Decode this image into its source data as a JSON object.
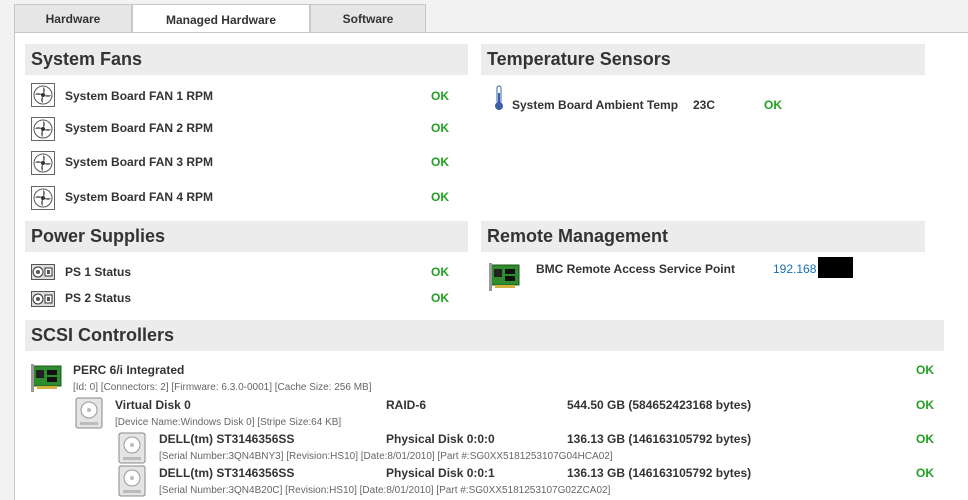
{
  "tabs": [
    {
      "label": "Hardware"
    },
    {
      "label": "Managed Hardware"
    },
    {
      "label": "Software"
    }
  ],
  "fans": {
    "title": "System Fans",
    "items": [
      {
        "label": "System Board FAN 1 RPM",
        "status": "OK"
      },
      {
        "label": "System Board FAN 2 RPM",
        "status": "OK"
      },
      {
        "label": "System Board FAN 3 RPM",
        "status": "OK"
      },
      {
        "label": "System Board FAN 4 RPM",
        "status": "OK"
      }
    ]
  },
  "temps": {
    "title": "Temperature Sensors",
    "items": [
      {
        "label": "System Board Ambient Temp",
        "value": "23C",
        "status": "OK"
      }
    ]
  },
  "power": {
    "title": "Power Supplies",
    "items": [
      {
        "label": "PS 1 Status",
        "status": "OK"
      },
      {
        "label": "PS 2 Status",
        "status": "OK"
      }
    ]
  },
  "remote": {
    "title": "Remote Management",
    "label": "BMC Remote Access Service Point",
    "address": "192.168"
  },
  "scsi": {
    "title": "SCSI Controllers",
    "controller": {
      "name": "PERC 6/i Integrated",
      "details": "[Id: 0] [Connectors: 2] [Firmware: 6.3.0-0001] [Cache Size: 256 MB]",
      "status": "OK"
    },
    "virtual_disk": {
      "name": "Virtual Disk 0",
      "raid": "RAID-6",
      "size": "544.50 GB (584652423168 bytes)",
      "details": "[Device Name:Windows Disk 0] [Stripe Size:64 KB]",
      "status": "OK"
    },
    "physical_disks": [
      {
        "name": "DELL(tm) ST3146356SS",
        "id": "Physical Disk 0:0:0",
        "size": "136.13 GB (146163105792 bytes)",
        "details": "[Serial Number:3QN4BNY3] [Revision:HS10] [Date:8/01/2010] [Part #:SG0XX5181253107G04HCA02]",
        "status": "OK"
      },
      {
        "name": "DELL(tm) ST3146356SS",
        "id": "Physical Disk 0:0:1",
        "size": "136.13 GB (146163105792 bytes)",
        "details": "[Serial Number:3QN4B20C] [Revision:HS10] [Date:8/01/2010] [Part #:SG0XX5181253107G02ZCA02]",
        "status": "OK"
      }
    ]
  },
  "colors": {
    "ok": "#22a022",
    "link": "#1a6eb4",
    "section_header": "#ececec"
  }
}
